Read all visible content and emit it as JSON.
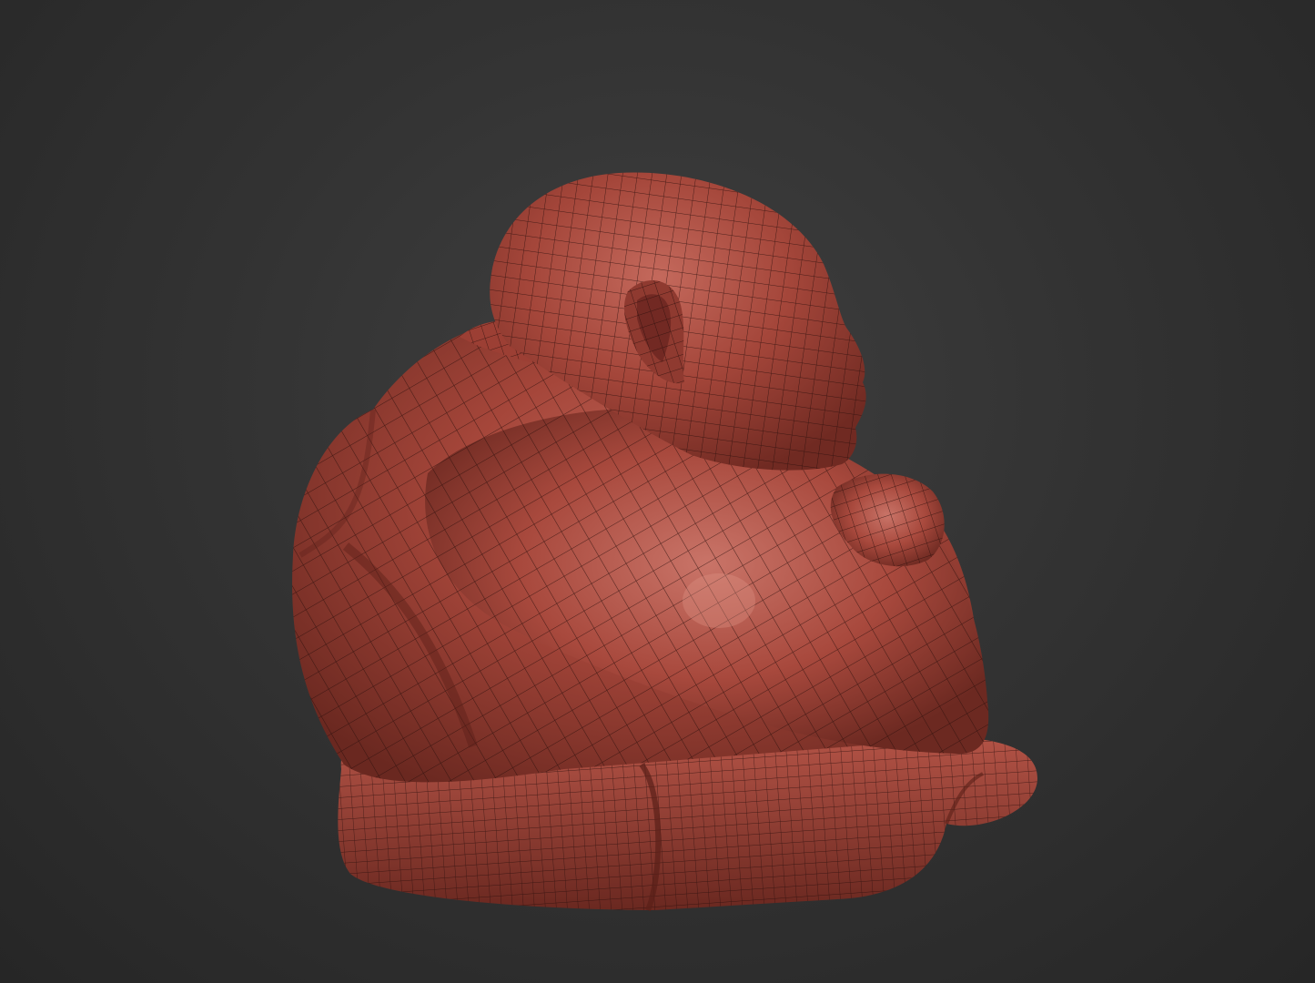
{
  "scene": {
    "subject": "buddha-statue-wireframe-icon",
    "colors": {
      "background_center": "#3f3f3f",
      "background_edge": "#262626",
      "clay_light": "#b55448",
      "clay_mid": "#9c3f34",
      "clay_dark": "#6e2a22",
      "wire": "#2a0f0c"
    }
  }
}
